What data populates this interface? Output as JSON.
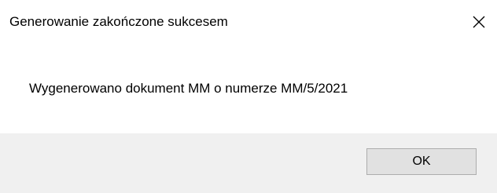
{
  "window": {
    "title": "Generowanie zakończone sukcesem",
    "close_icon": "close-icon"
  },
  "content": {
    "message": "Wygenerowano dokument MM o numerze MM/5/2021"
  },
  "footer": {
    "ok_label": "OK"
  },
  "colors": {
    "background": "#ffffff",
    "footer_background": "#f0f0f0",
    "button_background": "#e1e1e1",
    "button_border": "#adadad"
  }
}
